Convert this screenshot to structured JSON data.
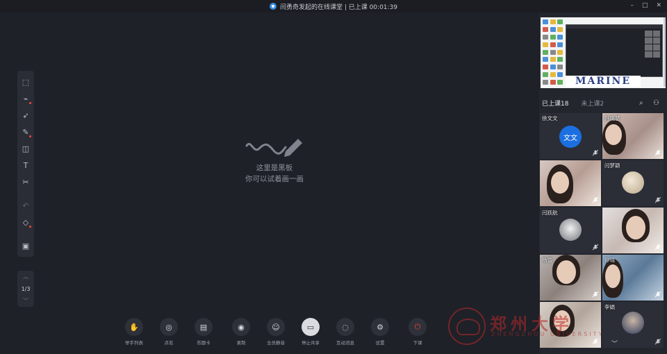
{
  "window": {
    "title": "闫勇奇发起的在线课堂 | 已上课 00:01:39",
    "controls": [
      "–",
      "□",
      "✕"
    ]
  },
  "board": {
    "empty_line1": "这里是黑板",
    "empty_line2": "你可以试着画一画"
  },
  "tools": [
    {
      "name": "select-area-tool",
      "glyph": "⬚"
    },
    {
      "name": "laser-pointer-tool",
      "glyph": "⌁"
    },
    {
      "name": "pointer-tool",
      "glyph": "➶"
    },
    {
      "name": "pen-tool",
      "glyph": "✎"
    },
    {
      "name": "shapes-tool",
      "glyph": "◫"
    },
    {
      "name": "text-tool",
      "glyph": "T"
    },
    {
      "name": "scissors-tool",
      "glyph": "✂"
    },
    {
      "name": "undo-tool",
      "glyph": "↶"
    },
    {
      "name": "eraser-tool",
      "glyph": "◇"
    },
    {
      "name": "toolbox-tool",
      "glyph": "▣"
    }
  ],
  "pager": {
    "page": "1/3"
  },
  "bottom_toolbar": [
    {
      "label": "举手列表",
      "glyph": "✋",
      "name": "raise-hand-list-button"
    },
    {
      "label": "点名",
      "glyph": "◎",
      "name": "roll-call-button"
    },
    {
      "label": "答题卡",
      "glyph": "▤",
      "name": "answer-card-button"
    },
    {
      "label": "录制",
      "glyph": "◉",
      "name": "record-button"
    },
    {
      "label": "全员静音",
      "glyph": "☺",
      "name": "mute-all-button"
    },
    {
      "label": "停止共享",
      "glyph": "▭",
      "name": "stop-share-button"
    },
    {
      "label": "互动消息",
      "glyph": "◌",
      "name": "interaction-messages-button"
    },
    {
      "label": "设置",
      "glyph": "⚙",
      "name": "settings-button"
    },
    {
      "label": "下课",
      "glyph": "⏻",
      "name": "end-class-button"
    }
  ],
  "right_panel": {
    "banner_text": "MARINE",
    "tab_attended": "已上课18",
    "tab_absent": "未上课2",
    "participants": [
      {
        "name": "徐文文",
        "avatar_text": "文文"
      },
      {
        "name": "韩璐慧",
        "avatar_text": ""
      },
      {
        "name": "",
        "avatar_text": ""
      },
      {
        "name": "闫梦颖",
        "avatar_text": ""
      },
      {
        "name": "闫跃航",
        "avatar_text": ""
      },
      {
        "name": "",
        "avatar_text": ""
      },
      {
        "name": "杨雪",
        "avatar_text": ""
      },
      {
        "name": "孙瑶",
        "avatar_text": ""
      },
      {
        "name": "",
        "avatar_text": ""
      },
      {
        "name": "李娟",
        "avatar_text": ""
      }
    ]
  },
  "watermark": {
    "text": "郑州大学",
    "sub": "ZHENGZHOU UNIVERSITY"
  },
  "colors": {
    "accent_blue": "#1c6fe0",
    "end_red": "#e2463d",
    "background": "#1e2026"
  }
}
